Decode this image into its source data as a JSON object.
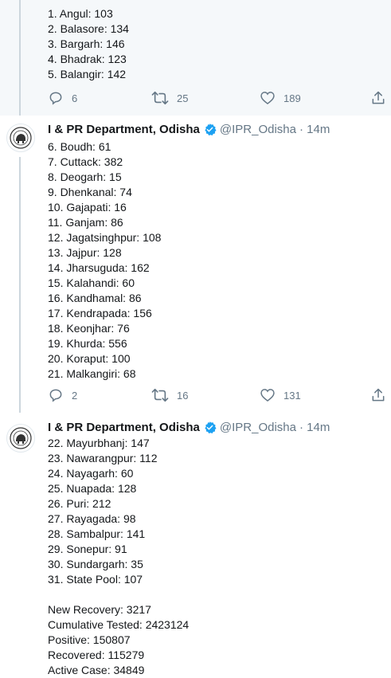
{
  "tweets": [
    {
      "lines": [
        "1. Angul: 103",
        "2. Balasore: 134",
        "3. Bargarh: 146",
        "4. Bhadrak: 123",
        "5. Balangir: 142"
      ],
      "replies": "6",
      "retweets": "25",
      "likes": "189"
    },
    {
      "name": "I & PR Department, Odisha",
      "handle": "@IPR_Odisha",
      "time": "· 14m",
      "lines": [
        "6. Boudh: 61",
        "7. Cuttack: 382",
        "8. Deogarh: 15",
        "9. Dhenkanal: 74",
        "10. Gajapati: 16",
        "11. Ganjam: 86",
        "12. Jagatsinghpur: 108",
        "13. Jajpur: 128",
        "14. Jharsuguda: 162",
        "15. Kalahandi: 60",
        "16. Kandhamal: 86",
        "17. Kendrapada: 156",
        "18. Keonjhar: 76",
        "19. Khurda: 556",
        "20. Koraput: 100",
        "21. Malkangiri: 68"
      ],
      "replies": "2",
      "retweets": "16",
      "likes": "131"
    },
    {
      "name": "I & PR Department, Odisha",
      "handle": "@IPR_Odisha",
      "time": "· 14m",
      "lines": [
        "22. Mayurbhanj: 147",
        "23. Nawarangpur: 112",
        "24. Nayagarh: 60",
        "25. Nuapada: 128",
        "26. Puri: 212",
        "27. Rayagada: 98",
        "28. Sambalpur: 141",
        "29. Sonepur: 91",
        "30. Sundargarh: 35",
        "31. State Pool: 107"
      ],
      "summary": [
        "New Recovery: 3217",
        "Cumulative Tested: 2423124",
        "Positive: 150807",
        "Recovered: 115279",
        "Active Case: 34849"
      ]
    }
  ],
  "colors": {
    "accent": "#1da1f2",
    "muted": "#657786",
    "highlight_bg": "#f5f8fa",
    "thread_line": "#ccd6dd"
  },
  "icons": [
    "reply-icon",
    "retweet-icon",
    "like-icon",
    "share-icon",
    "verified-icon",
    "avatar-emblem"
  ]
}
